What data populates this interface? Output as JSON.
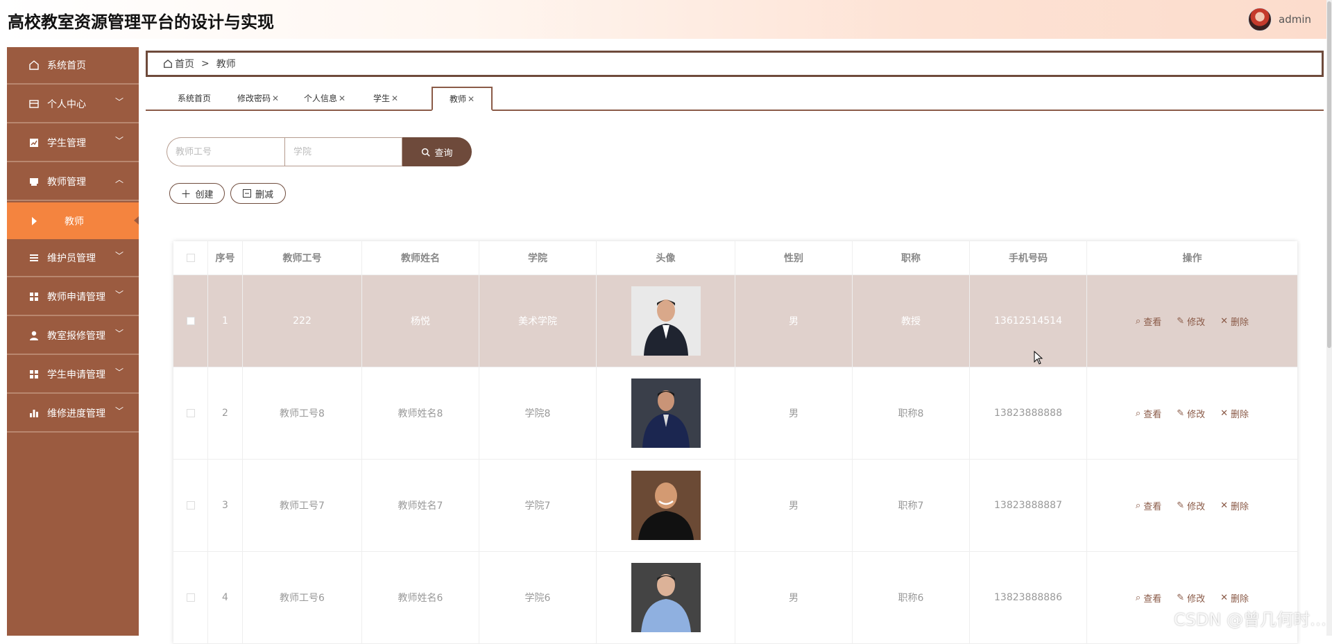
{
  "header": {
    "title": "高校教室资源管理平台的设计与实现",
    "username": "admin"
  },
  "sidebar": {
    "items": [
      {
        "label": "系统首页",
        "icon": "home-icon"
      },
      {
        "label": "个人中心",
        "icon": "card-icon"
      },
      {
        "label": "学生管理",
        "icon": "chart-icon"
      },
      {
        "label": "教师管理",
        "icon": "printer-icon"
      },
      {
        "label": "维护员管理",
        "icon": "list-icon"
      },
      {
        "label": "教师申请管理",
        "icon": "grid-icon"
      },
      {
        "label": "教室报修管理",
        "icon": "user-icon"
      },
      {
        "label": "学生申请管理",
        "icon": "grid-icon"
      },
      {
        "label": "维修进度管理",
        "icon": "bar-icon"
      }
    ],
    "active_sub": "教师"
  },
  "breadcrumb": {
    "home": "首页",
    "separator": ">",
    "current": "教师"
  },
  "tabs": [
    {
      "label": "系统首页"
    },
    {
      "label": "修改密码"
    },
    {
      "label": "个人信息"
    },
    {
      "label": "学生"
    },
    {
      "label": "教师"
    }
  ],
  "search": {
    "placeholder_id": "教师工号",
    "placeholder_college": "学院",
    "button": "查询"
  },
  "actions": {
    "create": "创建",
    "delete": "删减"
  },
  "table": {
    "headers": [
      "序号",
      "教师工号",
      "教师姓名",
      "学院",
      "头像",
      "性别",
      "职称",
      "手机号码",
      "操作"
    ],
    "rows": [
      {
        "index": "1",
        "teacher_id": "222",
        "name": "杨悦",
        "college": "美术学院",
        "gender": "男",
        "title": "教授",
        "phone": "13612514514"
      },
      {
        "index": "2",
        "teacher_id": "教师工号8",
        "name": "教师姓名8",
        "college": "学院8",
        "gender": "男",
        "title": "职称8",
        "phone": "13823888888"
      },
      {
        "index": "3",
        "teacher_id": "教师工号7",
        "name": "教师姓名7",
        "college": "学院7",
        "gender": "男",
        "title": "职称7",
        "phone": "13823888887"
      },
      {
        "index": "4",
        "teacher_id": "教师工号6",
        "name": "教师姓名6",
        "college": "学院6",
        "gender": "男",
        "title": "职称6",
        "phone": "13823888886"
      }
    ],
    "ops": {
      "view": "查看",
      "edit": "修改",
      "delete": "删除"
    }
  },
  "watermark": "CSDN @曾几何时…",
  "colors": {
    "sidebar": "#9b5b40",
    "active": "#f4843f",
    "accent": "#6e4a3b",
    "highlight_row": "#e0d1cc"
  }
}
